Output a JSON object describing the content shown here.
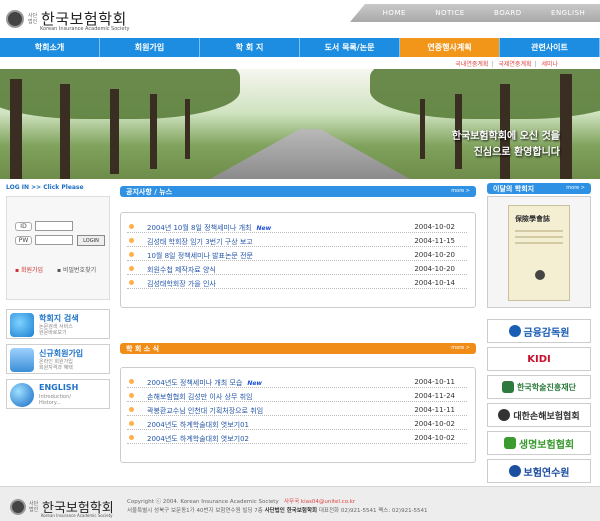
{
  "logo": {
    "small": "사단\n법인",
    "title": "한국보험학회",
    "english": "Korean Insurance Academic Society"
  },
  "topnav": [
    "HOME",
    "NOTICE",
    "BOARD",
    "ENGLISH"
  ],
  "mainnav": [
    "학회소개",
    "회원가입",
    "학 회 지",
    "도서 목록/논문",
    "연중행사계획",
    "관련사이트"
  ],
  "subnav": [
    "국내연중계획",
    "국제연중계획",
    "세미나"
  ],
  "hero": {
    "line1": "한국보험학회에 오신 것을",
    "line2": "진심으로 환영합니다"
  },
  "login": {
    "title": "LOG IN >>  Click Please",
    "id_label": "ID",
    "pw_label": "PW",
    "button": "LOGIN",
    "join": "회원가입",
    "find": "비밀번호찾기"
  },
  "side": [
    {
      "title": "학회지 검색",
      "desc": "논문검색 서비스\n원문바로보기"
    },
    {
      "title": "신규회원가입",
      "desc": "온라인 회원가입\n회원자격과 혜택"
    },
    {
      "title": "ENGLISH",
      "desc": "Introduction/\nHistory..."
    }
  ],
  "notice": {
    "title": "공지사항 / 뉴스",
    "more": "more >",
    "rows": [
      {
        "title": "2004년 10월 8일 정책세미나 개최",
        "new": "New",
        "date": "2004-10-02"
      },
      {
        "title": "김성태 학회장 임기 3번기 구상 보고",
        "new": "",
        "date": "2004-11-15"
      },
      {
        "title": "10월 8일 정책세미나 발표논문 전문",
        "new": "",
        "date": "2004-10-20"
      },
      {
        "title": "회원수첩 제작자료 양식",
        "new": "",
        "date": "2004-10-20"
      },
      {
        "title": "김성태학회장 가을 인사",
        "new": "",
        "date": "2004-10-14"
      }
    ]
  },
  "photo": {
    "title": "학 회 소 식",
    "more": "more >",
    "rows": [
      {
        "title": "2004년도 정책세미나 개최 모습",
        "new": "New",
        "date": "2004-10-11"
      },
      {
        "title": "손해보험협회 김성만 이사 상무 취임",
        "new": "",
        "date": "2004-11-24"
      },
      {
        "title": "곽봉환교수님 인천대 기획처장으로 취임",
        "new": "",
        "date": "2004-11-11"
      },
      {
        "title": "2004년도 하계학술대회 엿보기01",
        "new": "",
        "date": "2004-10-02"
      },
      {
        "title": "2004년도 하계학술대회 엿보기02",
        "new": "",
        "date": "2004-10-02"
      }
    ]
  },
  "book": {
    "title": "이달의 학회지",
    "more": "more >",
    "cover_title": "保險學會誌"
  },
  "partners": [
    {
      "name": "금융감독원",
      "color": "#1a5fb4"
    },
    {
      "name": "KIDI",
      "color": "#c8102e"
    },
    {
      "name": "한국학술진흥재단",
      "color": "#2c7a3d"
    },
    {
      "name": "대한손해보험협회",
      "color": "#333333"
    },
    {
      "name": "생명보험협회",
      "color": "#3b9b2f"
    },
    {
      "name": "보험연수원",
      "color": "#1d4fa0"
    }
  ],
  "footer": {
    "copyright": "Copyright ⓒ 2004. Korean Insurance Academic Society",
    "secretary": "사무국",
    "email": "kias04@unitel.co.kr",
    "address": "서울특별시 성북구 보문동1가 40번지 보험연수원 빌딩 7층",
    "org": "사단법인 한국보험학회",
    "phone": "대표전화 02)921-5541",
    "fax": "팩스: 02)921-5541"
  }
}
